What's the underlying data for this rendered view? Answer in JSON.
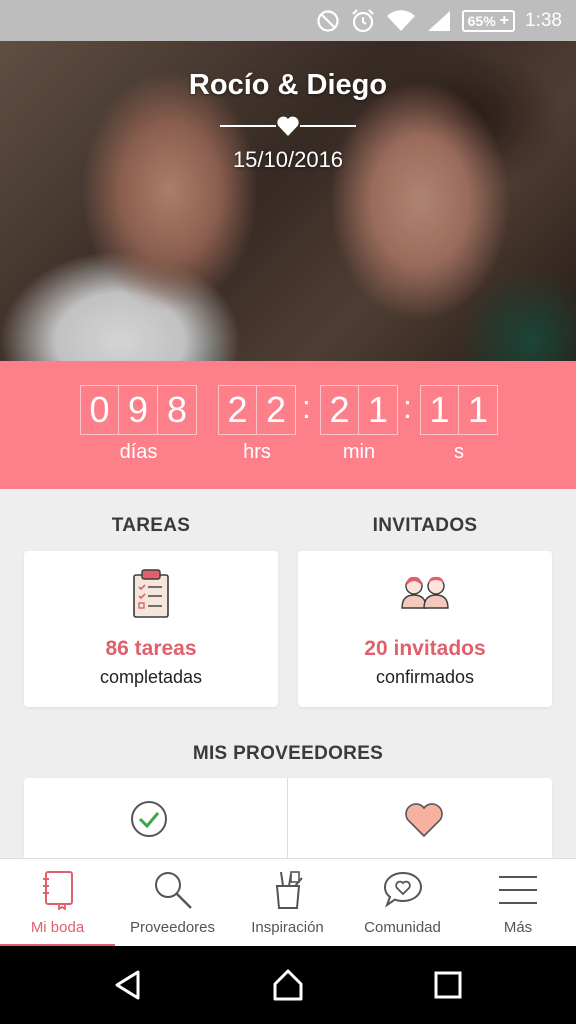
{
  "status_bar": {
    "battery_percent": "65%",
    "time": "1:38"
  },
  "hero": {
    "couple_names": "Rocío & Diego",
    "wedding_date": "15/10/2016"
  },
  "countdown": {
    "days_digits": [
      "0",
      "9",
      "8"
    ],
    "hours_digits": [
      "2",
      "2"
    ],
    "minutes_digits": [
      "2",
      "1"
    ],
    "seconds_digits": [
      "1",
      "1"
    ],
    "separator": ":",
    "days_label": "días",
    "hours_label": "hrs",
    "minutes_label": "min",
    "seconds_label": "s"
  },
  "tasks": {
    "title": "TAREAS",
    "count_text": "86 tareas",
    "status_text": "completadas"
  },
  "guests": {
    "title": "INVITADOS",
    "count_text": "20 invitados",
    "status_text": "confirmados"
  },
  "providers": {
    "title": "MIS PROVEEDORES"
  },
  "bottom_nav": {
    "items": [
      {
        "label": "Mi boda",
        "icon": "notebook-icon",
        "active": true
      },
      {
        "label": "Proveedores",
        "icon": "search-icon",
        "active": false
      },
      {
        "label": "Inspiración",
        "icon": "brush-cup-icon",
        "active": false
      },
      {
        "label": "Comunidad",
        "icon": "chat-heart-icon",
        "active": false
      },
      {
        "label": "Más",
        "icon": "menu-icon",
        "active": false
      }
    ]
  },
  "colors": {
    "accent": "#fc7f8a",
    "accent_text": "#e0606c",
    "background": "#eeeeee"
  }
}
